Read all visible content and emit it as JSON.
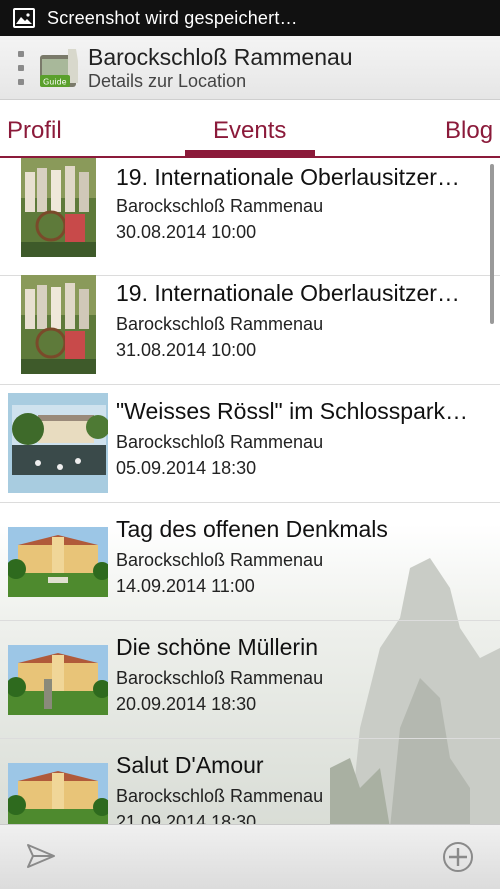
{
  "status_bar": {
    "icon": "image-icon",
    "text": "Screenshot wird gespeichert…"
  },
  "header": {
    "logo_text": "Guide",
    "title": "Barockschloß Rammenau",
    "subtitle": "Details zur Location"
  },
  "tabs": [
    {
      "label": "Profil",
      "active": false
    },
    {
      "label": "Events",
      "active": true
    },
    {
      "label": "Blog",
      "active": false
    }
  ],
  "events": [
    {
      "title": "19. Internationale Oberlausitzer…",
      "venue": "Barockschloß Rammenau",
      "date": "30.08.2014  10:00",
      "thumb": "people-photo"
    },
    {
      "title": "19. Internationale Oberlausitzer…",
      "venue": "Barockschloß Rammenau",
      "date": "31.08.2014  10:00",
      "thumb": "people-photo"
    },
    {
      "title": "\"Weisses Rössl\" im Schlosspark…",
      "venue": "Barockschloß Rammenau",
      "date": "05.09.2014  18:30",
      "thumb": "park-photo"
    },
    {
      "title": "Tag des offenen Denkmals",
      "venue": "Barockschloß Rammenau",
      "date": "14.09.2014  11:00",
      "thumb": "castle-photo"
    },
    {
      "title": "Die schöne Müllerin",
      "venue": "Barockschloß Rammenau",
      "date": "20.09.2014  18:30",
      "thumb": "castle-photo"
    },
    {
      "title": "Salut D'Amour",
      "venue": "Barockschloß Rammenau",
      "date": "21.09.2014  18:30",
      "thumb": "castle-photo"
    }
  ],
  "bottom_bar": {
    "left_icon": "send-icon",
    "right_icon": "add-circle-icon"
  },
  "colors": {
    "accent": "#8b1a3a",
    "status_bar": "#111111"
  }
}
